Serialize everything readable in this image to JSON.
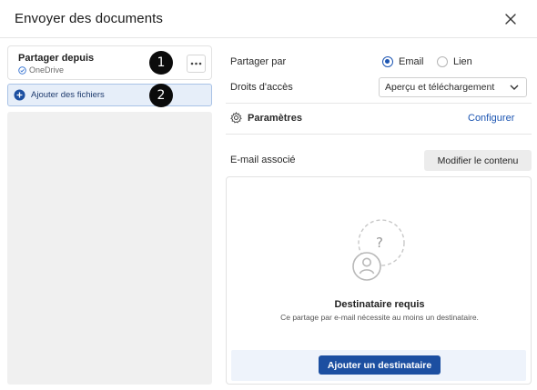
{
  "dialog": {
    "title": "Envoyer des documents"
  },
  "left_panel": {
    "share_from_label": "Partager depuis",
    "share_from_source": "OneDrive",
    "add_files_label": "Ajouter des fichiers",
    "badges": [
      "1",
      "2"
    ]
  },
  "share_by": {
    "label": "Partager par",
    "options": [
      "Email",
      "Lien"
    ],
    "selected": "Email"
  },
  "access_rights": {
    "label": "Droits d'accès",
    "value": "Aperçu et téléchargement"
  },
  "settings": {
    "label": "Paramètres",
    "configure_label": "Configurer"
  },
  "associated_email": {
    "label": "E-mail associé",
    "modify_label": "Modifier le contenu"
  },
  "recipients": {
    "required_title": "Destinataire requis",
    "required_description": "Ce partage par e-mail nécessite au moins un destinataire.",
    "add_recipient_label": "Ajouter un destinataire"
  },
  "colors": {
    "accent": "#1c55b2",
    "primary_button": "#1c4fa1",
    "add_files_bg": "#e6eef9",
    "left_list_bg": "#f0f0f0",
    "badge": "#0b0b0b"
  },
  "icons": {
    "close": "close-icon",
    "more": "more-horizontal-icon",
    "add": "plus-circle-icon",
    "onedrive_check": "check-circle-icon",
    "settings": "gear-icon",
    "dropdown": "chevron-down-icon",
    "empty_recipient": "user-question-icon"
  }
}
